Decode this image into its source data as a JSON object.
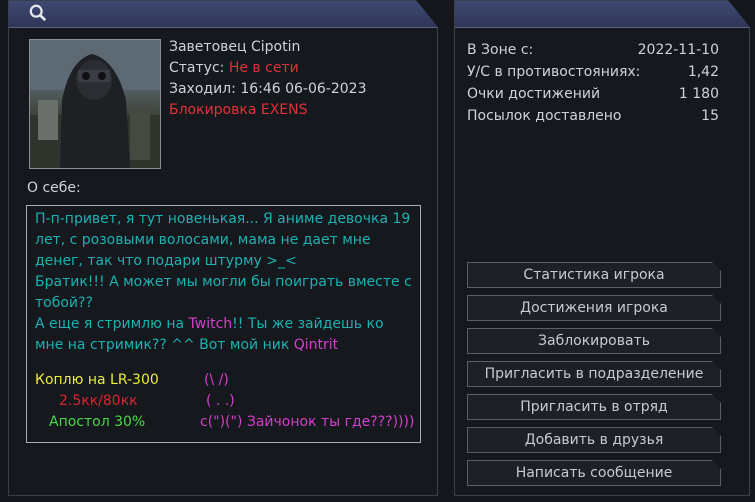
{
  "left": {
    "name": "Заветовец Cipotin",
    "status_label": "Статус:",
    "status_value": "Не в сети",
    "last_seen_label": "Заходил:",
    "last_seen_value": "16:46 06-06-2023",
    "ban_text": "Блокировка EXENS",
    "about_label": "О себе:",
    "about": {
      "line1": "П-п-привет, я тут новенькая... Я аниме девочка 19 лет, с розовыми волосами, мама не дает мне денег, так что подари штурму >_<",
      "line2": "Братик!!! А может мы могли бы поиграть вместе с тобой??",
      "line3_a": "А еще я стримлю на ",
      "line3_twitch": "Twitch",
      "line3_b": "!! Ты же зайдешь ко мне на стримик?? ^^ Вот мой ник ",
      "line3_nick": "Qintrit",
      "buy": "Коплю на LR-300",
      "price": "2.5кк/80кк",
      "apostol": "Апостол 30%",
      "face1": "(\\ /)",
      "face2": "( . .)",
      "face3": "c(\")(\") Зайчонок ты где???))))"
    }
  },
  "right": {
    "stats": [
      {
        "label": "В Зоне с:",
        "value": "2022-11-10"
      },
      {
        "label": "У/С в противостояниях:",
        "value": "1,42"
      },
      {
        "label": "Очки достижений",
        "value": "1 180"
      },
      {
        "label": "Посылок доставлено",
        "value": "15"
      }
    ],
    "buttons": {
      "stats": "Статистика игрока",
      "achievements": "Достижения игрока",
      "block": "Заблокировать",
      "invite_division": "Пригласить в подразделение",
      "invite_squad": "Пригласить в отряд",
      "add_friend": "Добавить в друзья",
      "message": "Написать сообщение"
    }
  }
}
